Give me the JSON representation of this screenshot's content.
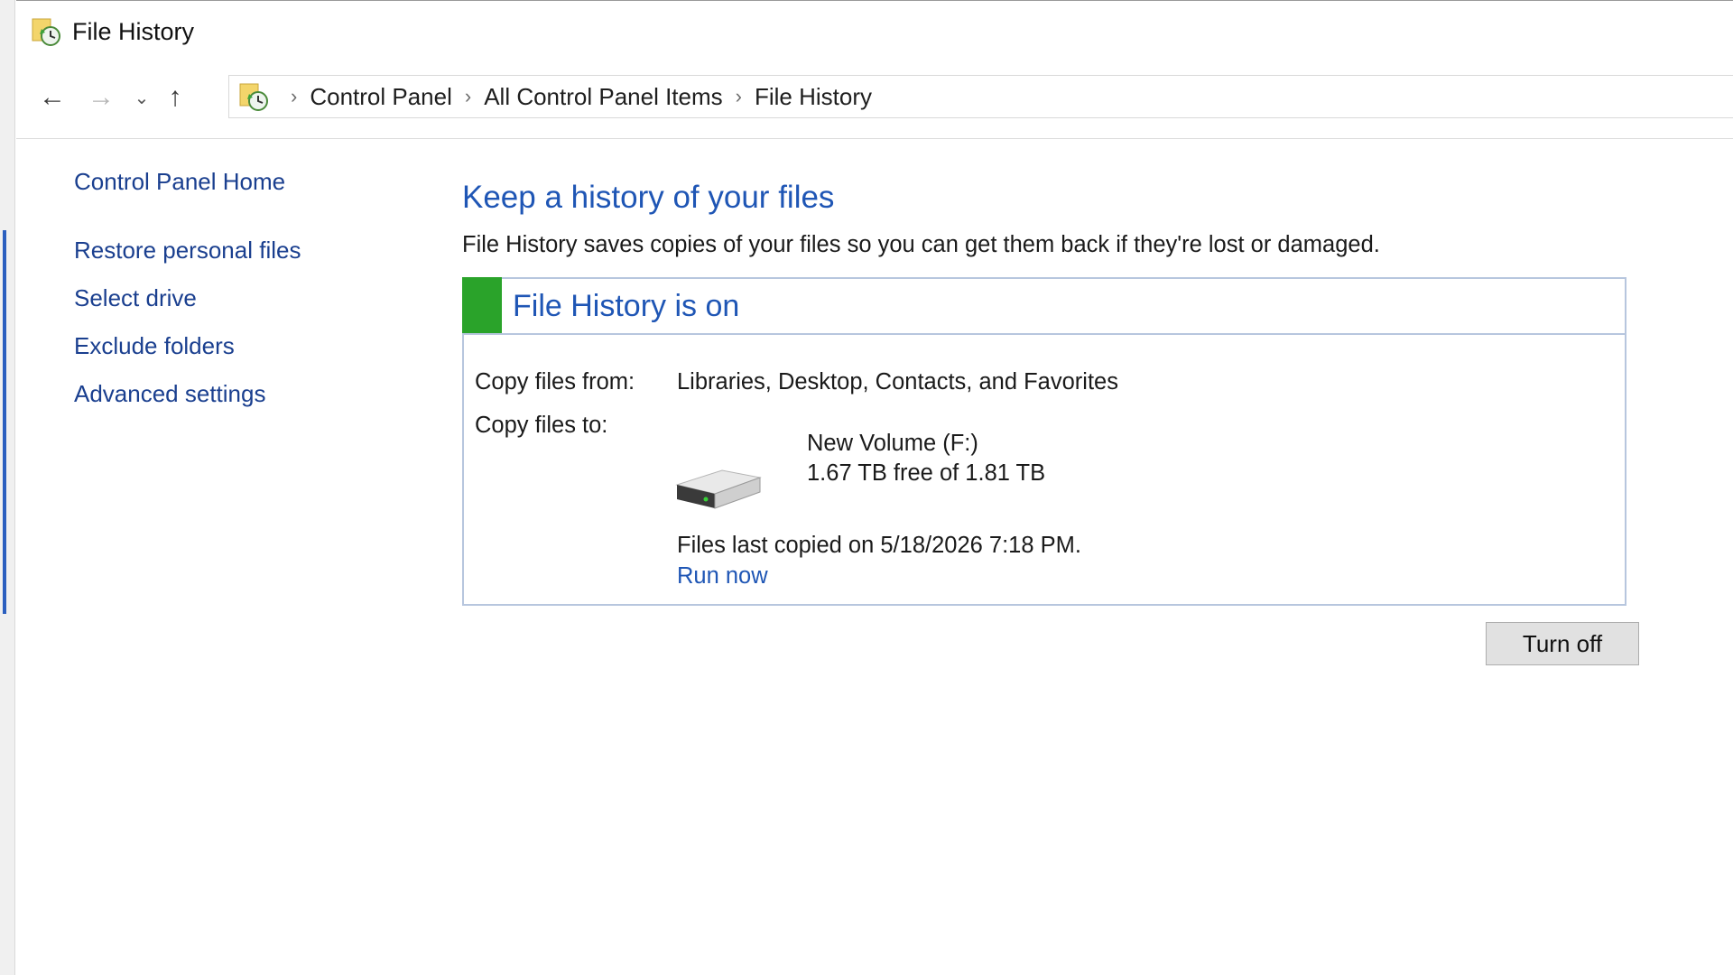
{
  "window": {
    "title": "File History",
    "app_icon": "file-history-icon"
  },
  "nav": {
    "back_icon": "back-arrow-icon",
    "forward_icon": "forward-arrow-icon",
    "recent_icon": "chevron-down-icon",
    "up_icon": "up-arrow-icon"
  },
  "breadcrumb": [
    "Control Panel",
    "All Control Panel Items",
    "File History"
  ],
  "sidebar": {
    "home": "Control Panel Home",
    "items": [
      "Restore personal files",
      "Select drive",
      "Exclude folders",
      "Advanced settings"
    ]
  },
  "main": {
    "heading": "Keep a history of your files",
    "description": "File History saves copies of your files so you can get them back if they're lost or damaged."
  },
  "status": {
    "title": "File History is on",
    "color": "#2aa32a",
    "copy_from_label": "Copy files from:",
    "copy_from_value": "Libraries, Desktop, Contacts, and Favorites",
    "copy_to_label": "Copy files to:",
    "drive_name": "New Volume (F:)",
    "drive_space": "1.67 TB free of 1.81 TB",
    "last_copied": "Files last copied on 5/18/2026 7:18 PM.",
    "run_now": "Run now"
  },
  "actions": {
    "turn_off": "Turn off"
  },
  "colors": {
    "link": "#1a3f8f",
    "heading": "#1f56b5",
    "accent": "#2b5fbf"
  }
}
